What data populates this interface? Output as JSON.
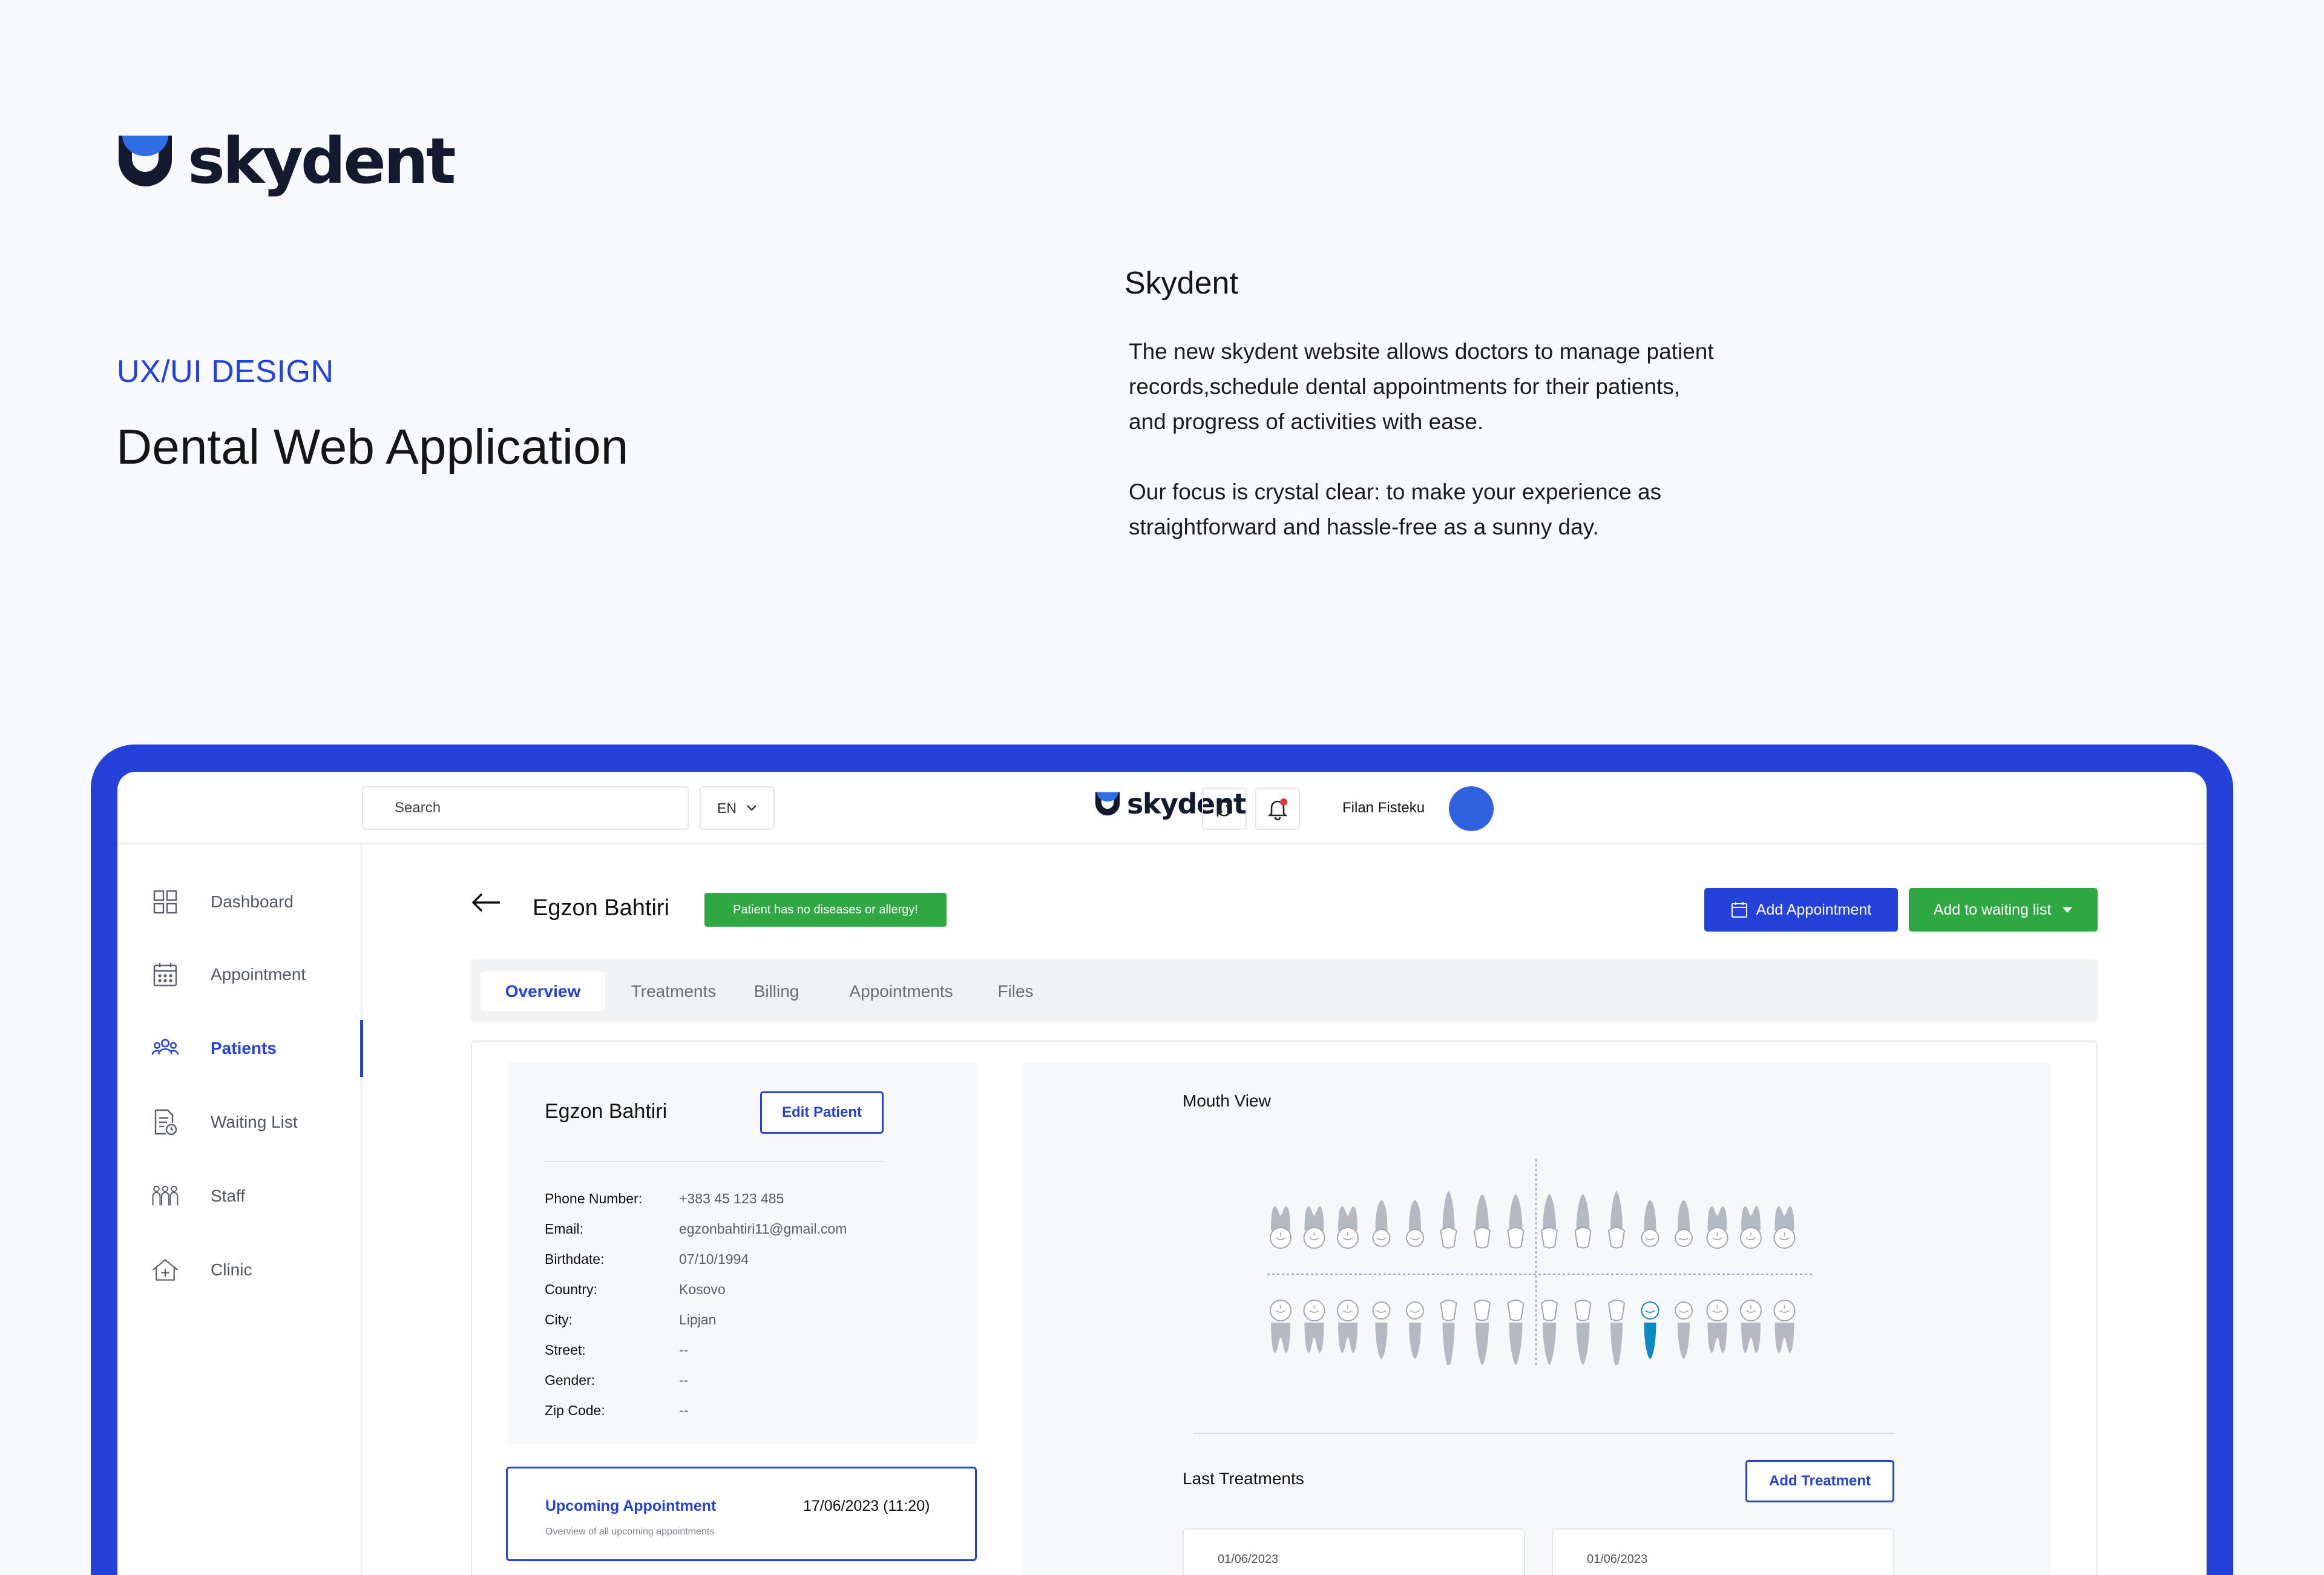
{
  "brand": {
    "name": "skydent",
    "colors": {
      "primary": "#2442d8",
      "dark": "#141a2e",
      "success": "#2ea843"
    }
  },
  "intro": {
    "kicker": "UX/UI DESIGN",
    "headline": "Dental Web Application",
    "project_title": "Skydent",
    "paragraph_1": "The new skydent website allows doctors to manage patient records,schedule dental appointments for their patients, and progress of activities with ease.",
    "paragraph_2": "Our focus is crystal clear: to make your experience as straightforward and hassle-free as a sunny day."
  },
  "topbar": {
    "search_placeholder": "Search",
    "language": "EN",
    "logo_text": "skydent",
    "user_name": "Filan Fisteku",
    "icons": [
      "refresh-icon",
      "bell-icon"
    ]
  },
  "sidebar": {
    "items": [
      {
        "label": "Dashboard",
        "icon": "grid-icon",
        "active": false
      },
      {
        "label": "Appointment",
        "icon": "calendar-icon",
        "active": false
      },
      {
        "label": "Patients",
        "icon": "people-icon",
        "active": true
      },
      {
        "label": "Waiting List",
        "icon": "document-clock-icon",
        "active": false
      },
      {
        "label": "Staff",
        "icon": "staff-icon",
        "active": false
      },
      {
        "label": "Clinic",
        "icon": "clinic-icon",
        "active": false
      }
    ]
  },
  "patient": {
    "name": "Egzon Bahtiri",
    "allergy_badge": "Patient has no diseases or allergy!",
    "actions": {
      "add_appointment": "Add Appointment",
      "add_to_waiting_list": "Add to waiting list"
    },
    "tabs": [
      "Overview",
      "Treatments",
      "Billing",
      "Appointments",
      "Files"
    ],
    "active_tab": "Overview",
    "card": {
      "name": "Egzon Bahtiri",
      "edit_label": "Edit Patient",
      "fields": [
        {
          "label": "Phone Number:",
          "value": "+383 45 123 485"
        },
        {
          "label": "Email:",
          "value": "egzonbahtiri11@gmail.com"
        },
        {
          "label": "Birthdate:",
          "value": "07/10/1994"
        },
        {
          "label": "Country:",
          "value": "Kosovo"
        },
        {
          "label": "City:",
          "value": "Lipjan"
        },
        {
          "label": "Street:",
          "value": "--"
        },
        {
          "label": "Gender:",
          "value": "--"
        },
        {
          "label": "Zip Code:",
          "value": "--"
        }
      ]
    },
    "upcoming": {
      "title": "Upcoming Appointment",
      "subtitle": "Overview of all upcoming appointments",
      "datetime": "17/06/2023 (11:20)"
    },
    "mouth_view": {
      "title": "Mouth View",
      "highlight_color": "#0b8ac4"
    },
    "last_treatments": {
      "title": "Last Treatments",
      "add_label": "Add Treatment",
      "items": [
        {
          "date": "01/06/2023"
        },
        {
          "date": "01/06/2023"
        }
      ]
    }
  }
}
